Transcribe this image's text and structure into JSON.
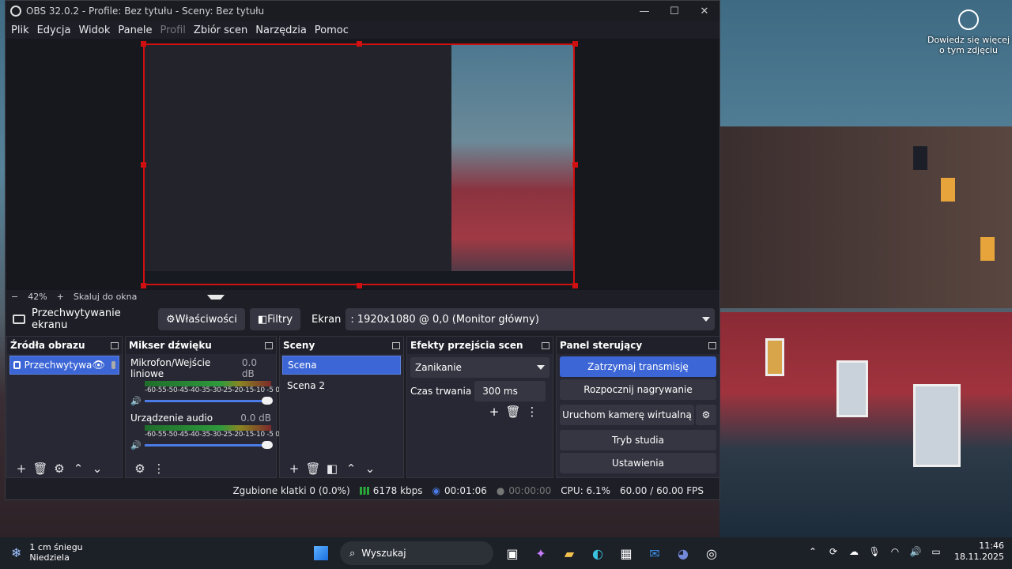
{
  "window": {
    "title": "OBS 32.0.2 - Profile: Bez tytułu - Sceny: Bez tytułu",
    "minimize": "—",
    "maximize": "☐",
    "close": "✕"
  },
  "menu": [
    "Plik",
    "Edycja",
    "Widok",
    "Panele",
    "Profil",
    "Zbiór scen",
    "Narzędzia",
    "Pomoc"
  ],
  "zoom": {
    "minus": "−",
    "value": "42%",
    "plus": "+",
    "scale_label": "Skaluj do okna"
  },
  "source_bar": {
    "capture_name": "Przechwytywanie ekranu",
    "properties": "Właściwości",
    "filters": "Filtry",
    "screen_label": "Ekran",
    "screen_value": ": 1920x1080 @ 0,0 (Monitor główny)"
  },
  "docks": {
    "sources": {
      "title": "Źródła obrazu",
      "item": "Przechwytywa"
    },
    "mixer": {
      "title": "Mikser dźwięku",
      "channels": [
        {
          "name": "Mikrofon/Wejście liniowe",
          "db": "0.0 dB"
        },
        {
          "name": "Urządzenie audio",
          "db": "0.0 dB"
        }
      ],
      "ticks": "-60-55-50-45-40-35-30-25-20-15-10 -5  0"
    },
    "scenes": {
      "title": "Sceny",
      "items": [
        "Scena",
        "Scena 2"
      ]
    },
    "transitions": {
      "title": "Efekty przejścia scen",
      "type": "Zanikanie",
      "duration_label": "Czas trwania",
      "duration": "300 ms"
    },
    "controls": {
      "title": "Panel sterujący",
      "stop_stream": "Zatrzymaj transmisję",
      "start_record": "Rozpocznij nagrywanie",
      "virtual_cam": "Uruchom kamerę wirtualną",
      "studio": "Tryb studia",
      "settings": "Ustawienia"
    }
  },
  "status": {
    "dropped": "Zgubione klatki 0 (0.0%)",
    "kbps": "6178 kbps",
    "stream_time": "00:01:06",
    "rec_time": "00:00:00",
    "cpu": "CPU: 6.1%",
    "fps": "60.00 / 60.00 FPS"
  },
  "desktop": {
    "caption": "Dowiedz się więcej o tym zdjęciu"
  },
  "taskbar": {
    "weather_temp": "1 cm śniegu",
    "weather_day": "Niedziela",
    "search": "Wyszukaj",
    "time": "11:46",
    "date": "18.11.2025"
  },
  "colors": {
    "accent": "#3c66d6",
    "selection_border": "#d01010",
    "bg": "#1e1f26"
  }
}
